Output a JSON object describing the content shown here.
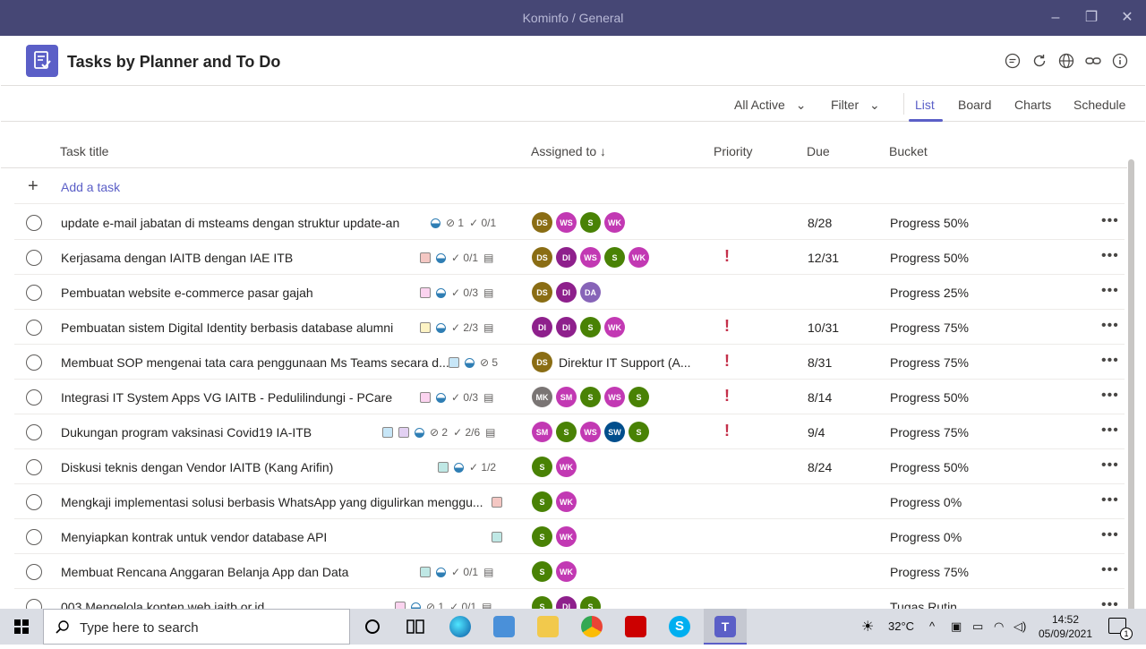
{
  "window": {
    "title": "Kominfo / General"
  },
  "app": {
    "title": "Tasks by Planner and To Do"
  },
  "toolbar": {
    "filter_active": "All Active",
    "filter": "Filter",
    "tabs": [
      "List",
      "Board",
      "Charts",
      "Schedule"
    ],
    "active_tab": "List"
  },
  "columns": {
    "title": "Task title",
    "assigned": "Assigned to ↓",
    "priority": "Priority",
    "due": "Due",
    "bucket": "Bucket"
  },
  "add_task": "Add a task",
  "colors": {
    "accent": "#5b5fc7",
    "titlebar": "#464775",
    "urgent": "#c4314b"
  },
  "tasks": [
    {
      "title": "update e-mail jabatan di msteams dengan struktur update-an",
      "attachments": "1",
      "checklist": "0/1",
      "due": "8/28",
      "bucket": "Progress 50%"
    },
    {
      "title": "Kerjasama dengan IAITB dengan IAE ITB",
      "checklist": "0/1",
      "due": "12/31",
      "bucket": "Progress 50%",
      "priority": "!"
    },
    {
      "title": "Pembuatan website e-commerce pasar gajah",
      "checklist": "0/3",
      "due": "",
      "bucket": "Progress 25%"
    },
    {
      "title": "Pembuatan sistem Digital Identity berbasis database alumni",
      "checklist": "2/3",
      "due": "10/31",
      "bucket": "Progress 75%",
      "priority": "!"
    },
    {
      "title": "Membuat SOP mengenai tata cara penggunaan Ms Teams secara d...",
      "attachments": "5",
      "assignee_text": "Direktur IT Support (A...",
      "due": "8/31",
      "bucket": "Progress 75%",
      "priority": "!"
    },
    {
      "title": "Integrasi IT System Apps VG IAITB - Pedulilindungi - PCare",
      "checklist": "0/3",
      "due": "8/14",
      "bucket": "Progress 50%",
      "priority": "!"
    },
    {
      "title": "Dukungan program vaksinasi Covid19 IA-ITB",
      "attachments": "2",
      "checklist": "2/6",
      "due": "9/4",
      "bucket": "Progress 75%",
      "priority": "!"
    },
    {
      "title": "Diskusi teknis dengan Vendor IAITB (Kang Arifin)",
      "checklist": "1/2",
      "due": "8/24",
      "bucket": "Progress 50%"
    },
    {
      "title": "Mengkaji implementasi solusi berbasis WhatsApp yang digulirkan menggu...",
      "due": "",
      "bucket": "Progress 0%"
    },
    {
      "title": "Menyiapkan kontrak untuk vendor database API",
      "due": "",
      "bucket": "Progress 0%"
    },
    {
      "title": "Membuat Rencana Anggaran Belanja App dan Data",
      "checklist": "0/1",
      "due": "",
      "bucket": "Progress 75%"
    },
    {
      "title": "003 Mengelola konten web iaitb.or.id",
      "attachments": "1",
      "checklist": "0/1",
      "due": "",
      "bucket": "Tugas Rutin"
    }
  ],
  "avatars": [
    [
      "DS",
      "WS",
      "S",
      "WK"
    ],
    [
      "DS",
      "DI",
      "WS",
      "S",
      "WK"
    ],
    [
      "DS",
      "DI",
      "DA"
    ],
    [
      "DI",
      "DI",
      "S",
      "WK"
    ],
    [
      "DS"
    ],
    [
      "MK",
      "SM",
      "S",
      "WS",
      "S"
    ],
    [
      "SM",
      "S",
      "WS",
      "SW",
      "S"
    ],
    [
      "S",
      "WK"
    ],
    [
      "S",
      "WK"
    ],
    [
      "S",
      "WK"
    ],
    [
      "S",
      "WK"
    ],
    [
      "S",
      "DI",
      "S"
    ]
  ],
  "taskbar": {
    "search_placeholder": "Type here to search",
    "weather": "32°C",
    "time": "14:52",
    "date": "05/09/2021",
    "notifications": "1"
  }
}
